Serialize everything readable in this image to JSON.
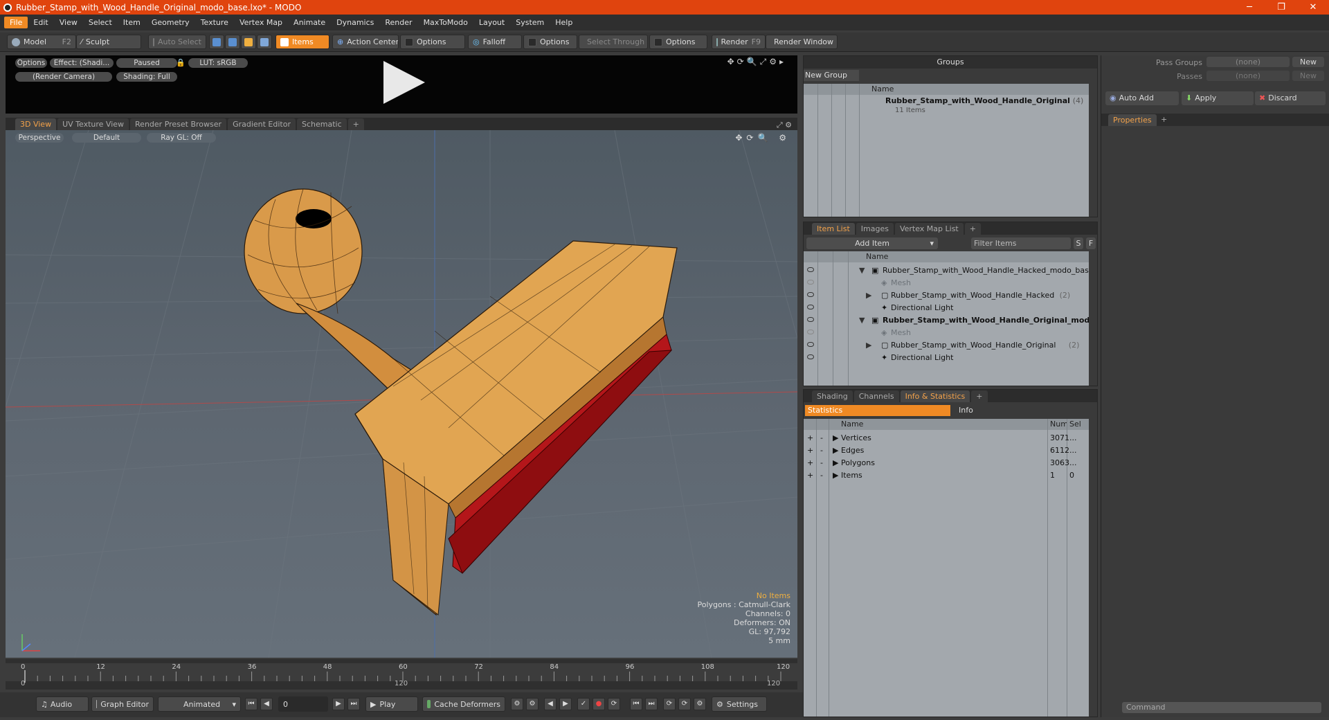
{
  "window": {
    "title": "Rubber_Stamp_with_Wood_Handle_Original_modo_base.lxo* - MODO",
    "minimize": "─",
    "restore": "❐",
    "close": "✕"
  },
  "menu": [
    "File",
    "Edit",
    "View",
    "Select",
    "Item",
    "Geometry",
    "Texture",
    "Vertex Map",
    "Animate",
    "Dynamics",
    "Render",
    "MaxToModo",
    "Layout",
    "System",
    "Help"
  ],
  "toolbar": {
    "model": "Model",
    "model_key": "F2",
    "sculpt": "Sculpt",
    "auto_select": "Auto Select",
    "items": "Items",
    "action_center": "Action Center",
    "options1": "Options",
    "falloff": "Falloff",
    "options2": "Options",
    "select_through": "Select Through",
    "options3": "Options",
    "render": "Render",
    "render_key": "F9",
    "render_window": "Render Window"
  },
  "preview": {
    "options": "Options",
    "effect": "Effect: (Shadi...",
    "paused": "Paused",
    "lut": "LUT: sRGB",
    "camera": "(Render Camera)",
    "shading": "Shading: Full"
  },
  "view_tabs": [
    "3D View",
    "UV Texture View",
    "Render Preset Browser",
    "Gradient Editor",
    "Schematic",
    "+"
  ],
  "viewport": {
    "perspective": "Perspective",
    "default": "Default",
    "raygl": "Ray GL: Off",
    "info": {
      "no_items": "No Items",
      "polygons": "Polygons : Catmull-Clark",
      "channels": "Channels: 0",
      "deformers": "Deformers: ON",
      "gl": "GL: 97,792",
      "unit": "5 mm"
    }
  },
  "timeline": {
    "ticks": [
      "0",
      "12",
      "24",
      "36",
      "48",
      "60",
      "72",
      "84",
      "96",
      "108",
      "120"
    ],
    "range_start": "0",
    "range_mid": "120",
    "range_end": "120"
  },
  "bottom": {
    "audio": "Audio",
    "graph_editor": "Graph Editor",
    "animated": "Animated",
    "frame": "0",
    "play": "Play",
    "cache_deformers": "Cache Deformers",
    "settings": "Settings"
  },
  "groups": {
    "header": "Groups",
    "new_group": "New Group",
    "col_name": "Name",
    "item_name": "Rubber_Stamp_with_Wood_Handle_Original",
    "item_count": "(4)",
    "item_sub": "11 Items"
  },
  "item_list": {
    "tabs": [
      "Item List",
      "Images",
      "Vertex Map List",
      "+"
    ],
    "add_item": "Add Item",
    "filter": "Filter Items",
    "s": "S",
    "f": "F",
    "col_name": "Name",
    "rows": [
      {
        "label": "Rubber_Stamp_with_Wood_Handle_Hacked_modo_base.l ...",
        "count": "",
        "type": "scene",
        "bold": false,
        "indent": 0
      },
      {
        "label": "Mesh",
        "count": "",
        "type": "mesh",
        "bold": false,
        "indent": 1
      },
      {
        "label": "Rubber_Stamp_with_Wood_Handle_Hacked",
        "count": "(2)",
        "type": "group",
        "bold": false,
        "indent": 1
      },
      {
        "label": "Directional Light",
        "count": "",
        "type": "light",
        "bold": false,
        "indent": 1
      },
      {
        "label": "Rubber_Stamp_with_Wood_Handle_Original_mod...",
        "count": "",
        "type": "scene",
        "bold": true,
        "indent": 0
      },
      {
        "label": "Mesh",
        "count": "",
        "type": "mesh",
        "bold": false,
        "indent": 1
      },
      {
        "label": "Rubber_Stamp_with_Wood_Handle_Original",
        "count": "(2)",
        "type": "group",
        "bold": false,
        "indent": 1
      },
      {
        "label": "Directional Light",
        "count": "",
        "type": "light",
        "bold": false,
        "indent": 1
      }
    ]
  },
  "stats": {
    "tabs": [
      "Shading",
      "Channels",
      "Info & Statistics",
      "+"
    ],
    "statistics": "Statistics",
    "info": "Info",
    "col_name": "Name",
    "col_num": "Num",
    "col_sel": "Sel",
    "rows": [
      {
        "name": "Vertices",
        "num": "3071",
        "sel": "..."
      },
      {
        "name": "Edges",
        "num": "6112",
        "sel": "..."
      },
      {
        "name": "Polygons",
        "num": "3063",
        "sel": "..."
      },
      {
        "name": "Items",
        "num": "1",
        "sel": "0"
      }
    ]
  },
  "right": {
    "pass_groups": "Pass Groups",
    "passes": "Passes",
    "none": "(none)",
    "new": "New",
    "auto_add": "Auto Add",
    "apply": "Apply",
    "discard": "Discard",
    "properties": "Properties",
    "plus": "+",
    "command": "Command"
  }
}
